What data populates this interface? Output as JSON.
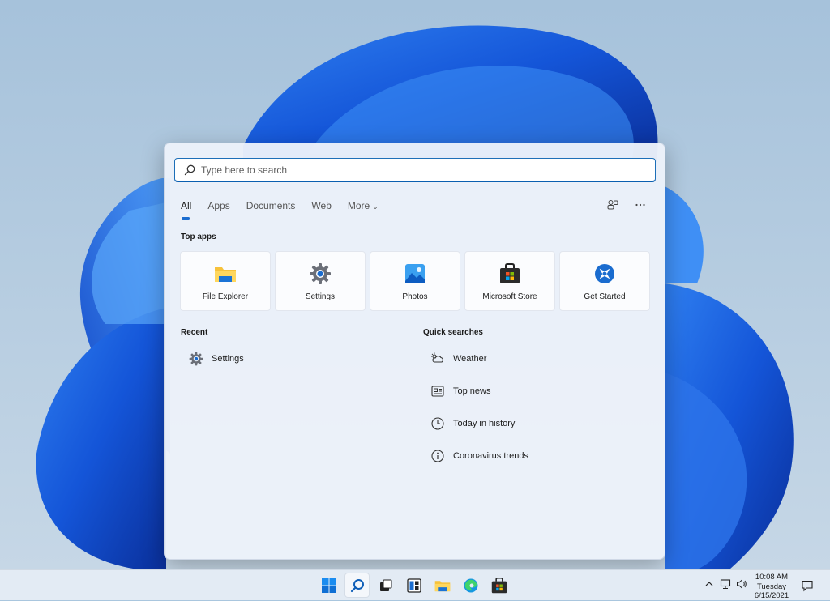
{
  "search": {
    "placeholder": "Type here to search"
  },
  "tabs": [
    {
      "label": "All",
      "active": true
    },
    {
      "label": "Apps"
    },
    {
      "label": "Documents"
    },
    {
      "label": "Web"
    },
    {
      "label": "More"
    }
  ],
  "top_apps": {
    "title": "Top apps",
    "items": [
      {
        "label": "File Explorer",
        "icon": "folder-icon"
      },
      {
        "label": "Settings",
        "icon": "gear-icon"
      },
      {
        "label": "Photos",
        "icon": "photos-icon"
      },
      {
        "label": "Microsoft Store",
        "icon": "store-icon"
      },
      {
        "label": "Get Started",
        "icon": "get-started-icon"
      }
    ]
  },
  "recent": {
    "title": "Recent",
    "items": [
      {
        "label": "Settings",
        "icon": "gear-icon"
      }
    ]
  },
  "quick_searches": {
    "title": "Quick searches",
    "items": [
      {
        "label": "Weather",
        "icon": "weather-icon"
      },
      {
        "label": "Top news",
        "icon": "news-icon"
      },
      {
        "label": "Today in history",
        "icon": "clock-icon"
      },
      {
        "label": "Coronavirus trends",
        "icon": "info-icon"
      }
    ]
  },
  "taskbar": {
    "apps": [
      "start-icon",
      "search-icon",
      "task-view-icon",
      "widgets-icon",
      "file-explorer-icon",
      "edge-icon",
      "store-icon"
    ],
    "time": "10:08 AM",
    "day": "Tuesday",
    "date": "6/15/2021"
  },
  "colors": {
    "accent": "#1a6ccf",
    "panel_bg": "#ecf1fa",
    "taskbar_bg": "#e3ebf4"
  }
}
